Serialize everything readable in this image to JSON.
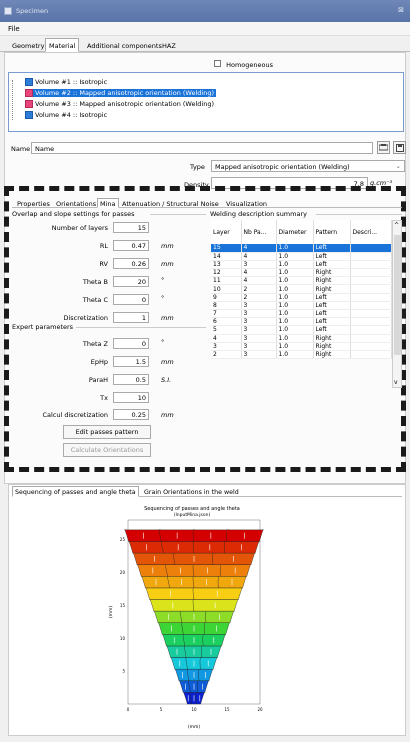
{
  "window": {
    "title": "Specimen",
    "close_glyph": "⊠"
  },
  "menu": {
    "file": "File"
  },
  "main_tabs": [
    {
      "label": "Geometry",
      "selected": false
    },
    {
      "label": "Material",
      "selected": true
    },
    {
      "label": "Additional components",
      "selected": false
    },
    {
      "label": "HAZ",
      "selected": false
    }
  ],
  "homogeneous": {
    "label": "Homogeneous",
    "checked": false
  },
  "volumes": [
    {
      "label": "Volume #1 :: Isotropic",
      "color": "#2f7bd8",
      "selected": false
    },
    {
      "label": "Volume #2 :: Mapped anisotropic orientation (Welding)",
      "color": "#e8457a",
      "selected": true
    },
    {
      "label": "Volume #3 :: Mapped anisotropic orientation (Welding)",
      "color": "#e8457a",
      "selected": false
    },
    {
      "label": "Volume #4 :: Isotropic",
      "color": "#2f7bd8",
      "selected": false
    }
  ],
  "name_field": {
    "label": "Name",
    "value": "Name"
  },
  "type_field": {
    "label": "Type",
    "value": "Mapped anisotropic orientation (Welding)"
  },
  "density": {
    "label": "Density",
    "value": "7.8",
    "unit": "g.cm⁻³"
  },
  "sub_tabs": [
    {
      "label": "Properties",
      "selected": false
    },
    {
      "label": "Orientations",
      "selected": false
    },
    {
      "label": "Mina",
      "selected": true
    },
    {
      "label": "Attenuation / Structural Noise",
      "selected": false
    },
    {
      "label": "Visualization",
      "selected": false
    }
  ],
  "overlap_group": "Overlap and slope settings for passes",
  "params": [
    {
      "label": "Number of layers",
      "value": "15",
      "unit": ""
    },
    {
      "label": "RL",
      "value": "0.47",
      "unit": "mm"
    },
    {
      "label": "RV",
      "value": "0.26",
      "unit": "mm"
    },
    {
      "label": "Theta B",
      "value": "20",
      "unit": "°"
    },
    {
      "label": "Theta C",
      "value": "0",
      "unit": "°"
    },
    {
      "label": "Discretization",
      "value": "1",
      "unit": "mm"
    }
  ],
  "expert_group": "Expert parameters",
  "expert_params": [
    {
      "label": "Theta Z",
      "value": "0",
      "unit": "°"
    },
    {
      "label": "EpHp",
      "value": "1.5",
      "unit": "mm"
    },
    {
      "label": "ParaH",
      "value": "0.5",
      "unit": "S.I."
    },
    {
      "label": "Tx",
      "value": "10",
      "unit": ""
    },
    {
      "label": "Calcul discretization",
      "value": "0.25",
      "unit": "mm"
    }
  ],
  "buttons": {
    "edit_passes": "Edit passes pattern",
    "calculate": "Calculate Orientations"
  },
  "welding_group": "Welding description summary",
  "welding_table": {
    "columns": [
      "Layer",
      "Nb Pa...",
      "Diameter",
      "Pattern",
      "Descri..."
    ],
    "rows": [
      [
        "15",
        "4",
        "1.0",
        "Left",
        ""
      ],
      [
        "14",
        "4",
        "1.0",
        "Left",
        ""
      ],
      [
        "13",
        "3",
        "1.0",
        "Left",
        ""
      ],
      [
        "12",
        "4",
        "1.0",
        "Right",
        ""
      ],
      [
        "11",
        "4",
        "1.0",
        "Right",
        ""
      ],
      [
        "10",
        "2",
        "1.0",
        "Right",
        ""
      ],
      [
        "9",
        "2",
        "1.0",
        "Left",
        ""
      ],
      [
        "8",
        "3",
        "1.0",
        "Left",
        ""
      ],
      [
        "7",
        "3",
        "1.0",
        "Left",
        ""
      ],
      [
        "6",
        "3",
        "1.0",
        "Left",
        ""
      ],
      [
        "5",
        "3",
        "1.0",
        "Left",
        ""
      ],
      [
        "4",
        "3",
        "1.0",
        "Right",
        ""
      ],
      [
        "3",
        "3",
        "1.0",
        "Right",
        ""
      ],
      [
        "2",
        "3",
        "1.0",
        "Right",
        ""
      ]
    ],
    "selected_index": 0
  },
  "bottom_tabs": [
    {
      "label": "Sequencing of passes and angle theta",
      "selected": true
    },
    {
      "label": "Grain Orientations in the weld",
      "selected": false
    }
  ],
  "chart_data": {
    "type": "heatmap",
    "title": "Sequencing of passes and angle theta",
    "subtitle": "(InputMina.json)",
    "xlabel": "(mm)",
    "ylabel": "(mm)",
    "x_ticks": [
      "0",
      "5",
      "10",
      "15",
      "20"
    ],
    "y_ticks": [
      "5",
      "10",
      "15",
      "20",
      "25"
    ],
    "xlim": [
      0,
      20
    ],
    "ylim": [
      0,
      28
    ],
    "layers": 15,
    "colors": {
      "bottom": "#0a1fd0",
      "top": "#d40000"
    }
  }
}
